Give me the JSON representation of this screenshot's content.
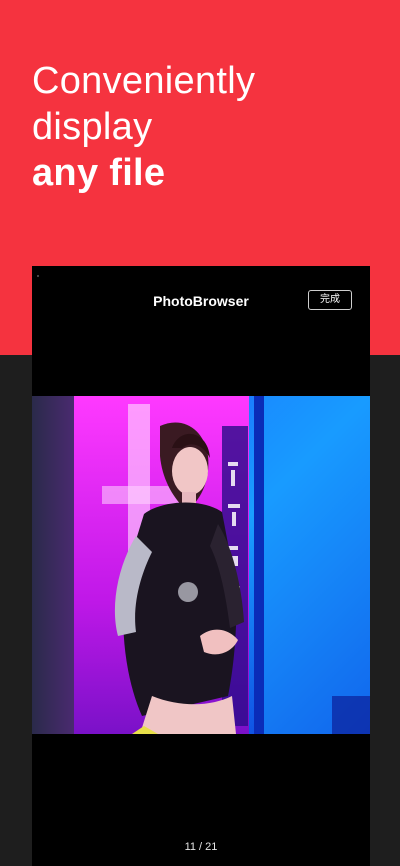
{
  "hero": {
    "line1": "Conveniently",
    "line2": "display",
    "line3": "any file"
  },
  "photo_browser": {
    "title": "PhotoBrowser",
    "done_label": "完成",
    "page_indicator": "11 / 21"
  },
  "colors": {
    "accent": "#f5333f",
    "dark_bg": "#1e1e1e",
    "viewer_bg": "#000000"
  },
  "icons": {
    "photo": "neon-portrait-photo"
  }
}
